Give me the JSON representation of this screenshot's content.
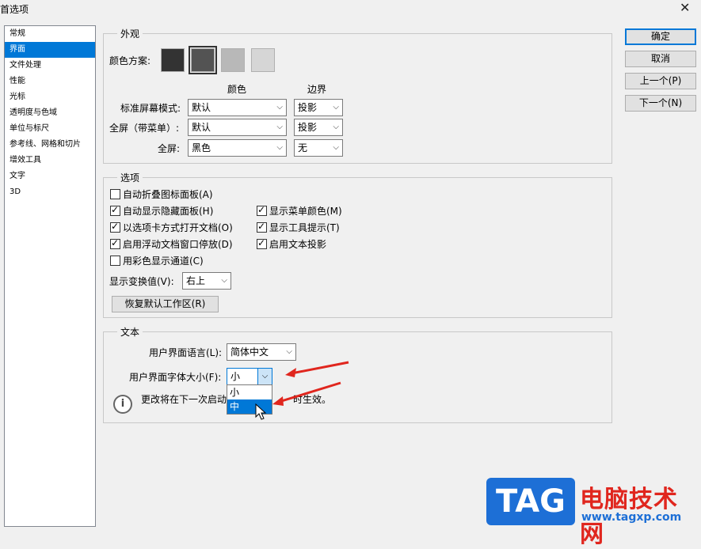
{
  "window": {
    "title": "首选项",
    "close_glyph": "✕"
  },
  "sidebar": {
    "items": [
      {
        "label": "常规"
      },
      {
        "label": "界面"
      },
      {
        "label": "文件处理"
      },
      {
        "label": "性能"
      },
      {
        "label": "光标"
      },
      {
        "label": "透明度与色域"
      },
      {
        "label": "单位与标尺"
      },
      {
        "label": "参考线、网格和切片"
      },
      {
        "label": "增效工具"
      },
      {
        "label": "文字"
      },
      {
        "label": "3D"
      }
    ],
    "selected_index": 1
  },
  "appearance": {
    "legend": "外观",
    "color_scheme_label": "颜色方案:",
    "swatches": [
      "#333333",
      "#535353",
      "#b8b8b8",
      "#d6d6d6"
    ],
    "selected_swatch": 1,
    "col_color": "颜色",
    "col_border": "边界",
    "rows": [
      {
        "label": "标准屏幕模式:",
        "color": "默认",
        "border": "投影"
      },
      {
        "label": "全屏（带菜单）:",
        "color": "默认",
        "border": "投影"
      },
      {
        "label": "全屏:",
        "color": "黑色",
        "border": "无"
      }
    ]
  },
  "options": {
    "legend": "选项",
    "left_checks": [
      {
        "label": "自动折叠图标面板(A)",
        "checked": false
      },
      {
        "label": "自动显示隐藏面板(H)",
        "checked": true
      },
      {
        "label": "以选项卡方式打开文档(O)",
        "checked": true
      },
      {
        "label": "启用浮动文档窗口停放(D)",
        "checked": true
      },
      {
        "label": "用彩色显示通道(C)",
        "checked": false
      }
    ],
    "right_checks": [
      {
        "label": "显示菜单颜色(M)",
        "checked": true
      },
      {
        "label": "显示工具提示(T)",
        "checked": true
      },
      {
        "label": "启用文本投影",
        "checked": true
      }
    ],
    "transform_label": "显示变换值(V):",
    "transform_value": "右上",
    "restore_button": "恢复默认工作区(R)"
  },
  "text_section": {
    "legend": "文本",
    "language_label": "用户界面语言(L):",
    "language_value": "简体中文",
    "font_size_label": "用户界面字体大小(F):",
    "font_size_value": "小",
    "font_size_options": [
      "小",
      "中"
    ],
    "highlighted_option": 1,
    "info_text_before": "更改将在下一次启动",
    "info_text_after": "时生效。",
    "info_icon_glyph": "i"
  },
  "buttons": {
    "ok": "确定",
    "cancel": "取消",
    "prev": "上一个(P)",
    "next": "下一个(N)"
  },
  "watermark": {
    "tag": "TAG",
    "brand": "电脑技术网",
    "url": "www.tagxp.com"
  },
  "colors": {
    "selection": "#0078d7",
    "annotation_arrow": "#e0261e"
  }
}
